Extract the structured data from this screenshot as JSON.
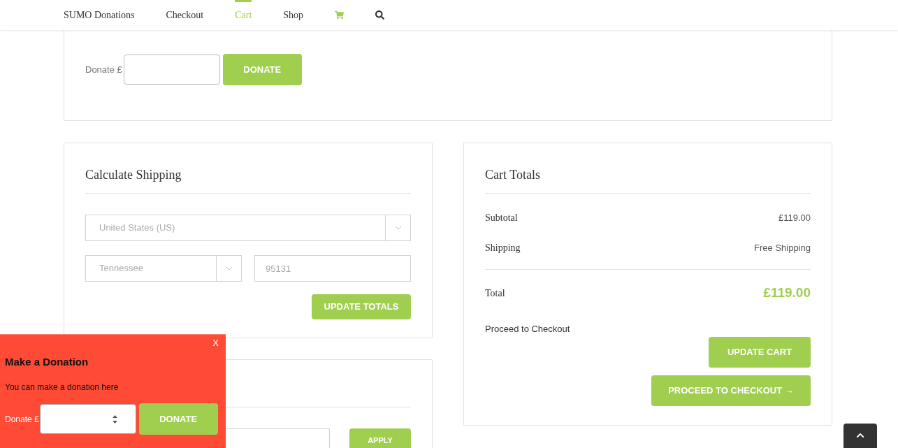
{
  "nav": {
    "items": [
      {
        "label": "SUMO Donations",
        "kind": "text",
        "selected": false
      },
      {
        "label": "Checkout",
        "kind": "text",
        "selected": false
      },
      {
        "label": "Cart",
        "kind": "text",
        "selected": true
      },
      {
        "label": "Shop",
        "kind": "text",
        "selected": false
      },
      {
        "kind": "cart",
        "selected": false
      },
      {
        "kind": "search",
        "selected": false
      }
    ]
  },
  "donation": {
    "label": "Donate £",
    "button": "DONATE"
  },
  "shipping": {
    "title": "Calculate Shipping",
    "country": "United States (US)",
    "state": "Tennessee",
    "postcode": "95131",
    "button": "UPDATE TOTALS"
  },
  "coupon": {
    "button": "APPLY"
  },
  "totals": {
    "title": "Cart Totals",
    "rows": [
      {
        "label": "Subtotal",
        "value": "£119.00"
      },
      {
        "label": "Shipping",
        "value": "Free Shipping"
      }
    ],
    "total_label": "Total",
    "total_value": "£119.00",
    "proceed_label": "Proceed to Checkout",
    "update_button": "UPDATE CART",
    "checkout_button": "PROCEED TO CHECKOUT →"
  },
  "popup": {
    "close": "X",
    "title": "Make a Donation",
    "text": "You can make a donation here",
    "label": "Donate £",
    "button": "DONATE"
  }
}
